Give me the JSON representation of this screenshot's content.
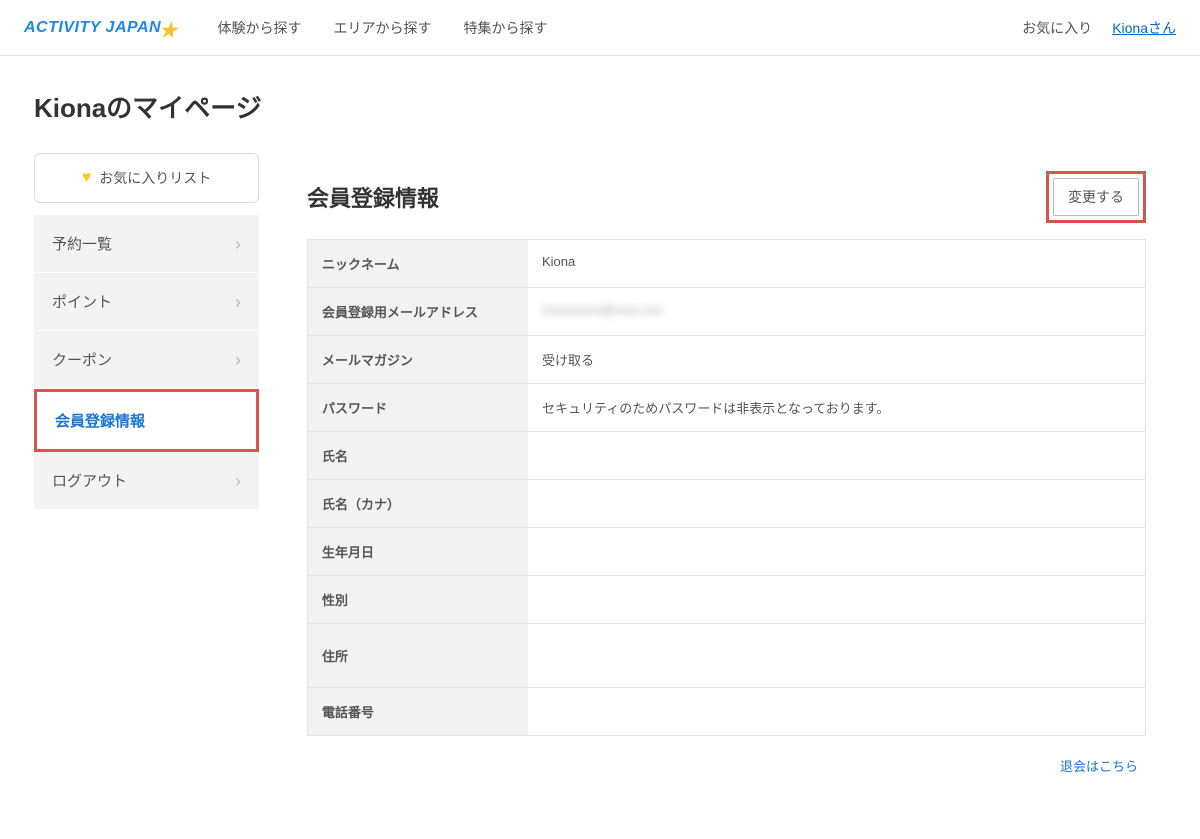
{
  "header": {
    "logo_text": "ACTIVITY JAPAN",
    "nav": [
      "体験から探す",
      "エリアから探す",
      "特集から探す"
    ],
    "favorite": "お気に入り",
    "user": "Kionaさん"
  },
  "page_title": "Kionaのマイページ",
  "sidebar": {
    "favorite_button": "お気に入りリスト",
    "items": [
      {
        "label": "予約一覧"
      },
      {
        "label": "ポイント"
      },
      {
        "label": "クーポン"
      },
      {
        "label": "会員登録情報"
      },
      {
        "label": "ログアウト"
      }
    ]
  },
  "main": {
    "section_title": "会員登録情報",
    "change_button": "変更する",
    "rows": [
      {
        "label": "ニックネーム",
        "value": "Kiona"
      },
      {
        "label": "会員登録用メールアドレス",
        "value": "xxxxxxxxx@xxxx.xxx"
      },
      {
        "label": "メールマガジン",
        "value": "受け取る"
      },
      {
        "label": "パスワード",
        "value": "セキュリティのためパスワードは非表示となっております。"
      },
      {
        "label": "氏名",
        "value": ""
      },
      {
        "label": "氏名（カナ）",
        "value": ""
      },
      {
        "label": "生年月日",
        "value": ""
      },
      {
        "label": "性別",
        "value": ""
      },
      {
        "label": "住所",
        "value": ""
      },
      {
        "label": "電話番号",
        "value": ""
      }
    ],
    "withdraw_link": "退会はこちら"
  }
}
